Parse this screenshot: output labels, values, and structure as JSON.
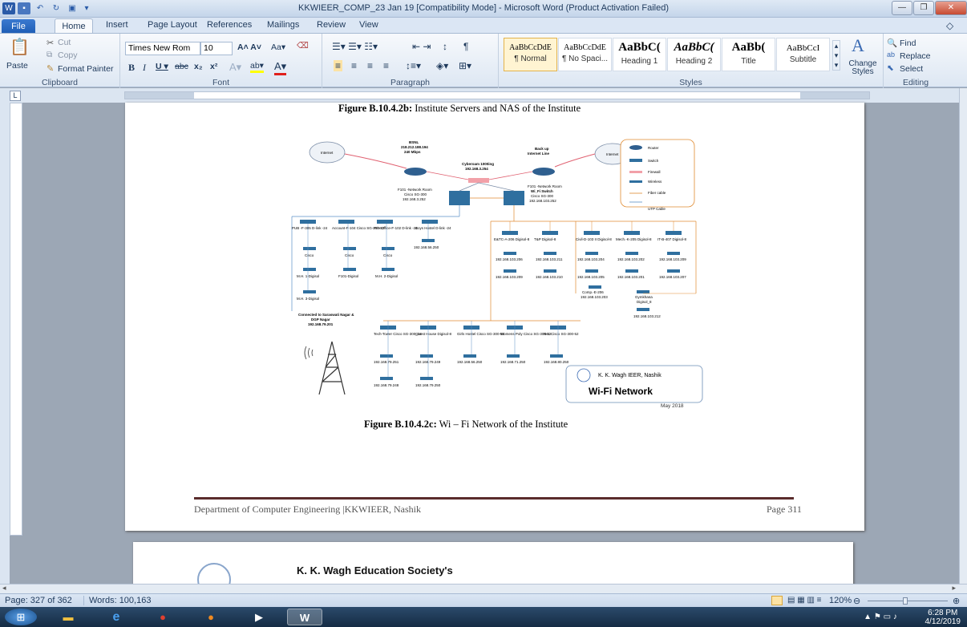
{
  "window": {
    "title": "KKWIEER_COMP_23 Jan 19 [Compatibility Mode] - Microsoft Word (Product Activation Failed)"
  },
  "tabs": [
    "File",
    "Home",
    "Insert",
    "Page Layout",
    "References",
    "Mailings",
    "Review",
    "View"
  ],
  "clipboard": {
    "paste": "Paste",
    "cut": "Cut",
    "copy": "Copy",
    "format_painter": "Format Painter",
    "label": "Clipboard"
  },
  "font": {
    "name": "Times New Rom",
    "size": "10",
    "label": "Font"
  },
  "paragraph": {
    "label": "Paragraph"
  },
  "styles": {
    "label": "Styles",
    "items": [
      {
        "preview": "AaBbCcDdE",
        "name": "¶ Normal"
      },
      {
        "preview": "AaBbCcDdE",
        "name": "¶ No Spaci..."
      },
      {
        "preview": "AaBbC(",
        "name": "Heading 1"
      },
      {
        "preview": "AaBbC(",
        "name": "Heading 2"
      },
      {
        "preview": "AaBb(",
        "name": "Title"
      },
      {
        "preview": "AaBbCcI",
        "name": "Subtitle"
      }
    ],
    "change": "Change Styles"
  },
  "editing": {
    "find": "Find",
    "replace": "Replace",
    "select": "Select",
    "label": "Editing"
  },
  "document": {
    "caption_top_bold": "Figure B.10.4.2b:",
    "caption_top_rest": " Institute Servers and NAS of the Institute",
    "caption_bottom_bold": "Figure B.10.4.2c:",
    "caption_bottom_rest": " Wi – Fi Network of the Institute",
    "footer_left": "Department of Computer Engineering |KKWIEER, Nashik",
    "footer_right": "Page 311",
    "page2_heading": "K. K. Wagh Education Society's"
  },
  "diagram": {
    "internet1": "Internet",
    "internet2": "Internet",
    "bsnl": "BSNL",
    "bsnl_ip": "218.212.188.194",
    "bsnl_speed": "240 Mbps",
    "backup": "Back up",
    "backup2": "Internet Line",
    "cyberoam": "Cyberoam 1000ing",
    "cyberoam_ip": "192.168.3.254",
    "room1": "F101 -Network Room",
    "room1_sw": "Cisco SG-300",
    "room1_ip": "192.168.3.252",
    "room2": "F101 -Network Room",
    "room2_sw": "Wi_Fi Switch",
    "room2_sw2": "Cisco SG-300",
    "room2_ip": "192.168.103.252",
    "legend": [
      "Router",
      "Switch",
      "Firewall",
      "Wireless",
      "Fiber cable",
      "UTP Cable"
    ],
    "nodes_left": [
      "PUB -F-305 D-link -24",
      "Account-F-104 Cisco SG-300-52",
      "Prin.Office-F-102 D-link -24",
      "Boys Hostel D-link -24"
    ],
    "boys_ip": "192.168.56.250",
    "wl_left": [
      "Cisco",
      "Cisco",
      "Cisco"
    ],
    "wl_left2": [
      "M.H. 1-Digisol",
      "F101-Digisol",
      "M.H. 2-Digisol"
    ],
    "mh3": "M.H. 3-Digisol",
    "nodes_right": [
      "E&TC-A-206 Digisol-8",
      "T&P Digisol-8",
      "Civil-D-103 II Digisol-8",
      "Mech.-K-205 Digisol-8",
      "IT-B-407 Digisol-8"
    ],
    "right_ip1": [
      "192.168.103.206",
      "192.168.103.211",
      "192.168.103.204",
      "192.168.103.202",
      "192.168.103.209"
    ],
    "right_ip2": [
      "192.168.103.209",
      "192.168.103.210",
      "192.168.103.205",
      "192.168.103.201",
      "192.168.103.207"
    ],
    "comp": "Comp.-E-206",
    "comp_ip": "192.168.103.203",
    "gym": "Gymkhana",
    "gym_sub": "Digisol_8",
    "gym_ip": "192.168.103.212",
    "connected": "Connected to Saraswati Nagar &",
    "connected2": "DGP Nagar",
    "connected_ip": "192.168.79.201",
    "nodes_bottom": [
      "Tech-Tower Cisco SG-300_24",
      "Guest House Digisol-8",
      "Girls Hostel Cisco SG-300-52",
      "Womens Poly Cisco SG-300-52",
      "Ncc Cisco SG-300-52"
    ],
    "bottom_ip": [
      "192.168.79.251",
      "192.168.79.249",
      "192.168.56.250",
      "192.168.71.250",
      "192.168.80.250"
    ],
    "bottom_ip2": [
      "192.168.79.248",
      "192.168.79.250"
    ],
    "logo_org": "K. K. Wagh IEER, Nashik",
    "logo_title": "Wi-Fi Network",
    "date": "May 2018"
  },
  "status": {
    "page": "Page: 327 of 362",
    "words": "Words: 100,163",
    "zoom": "120%"
  },
  "clock": {
    "time": "6:28 PM",
    "date": "4/12/2019"
  }
}
